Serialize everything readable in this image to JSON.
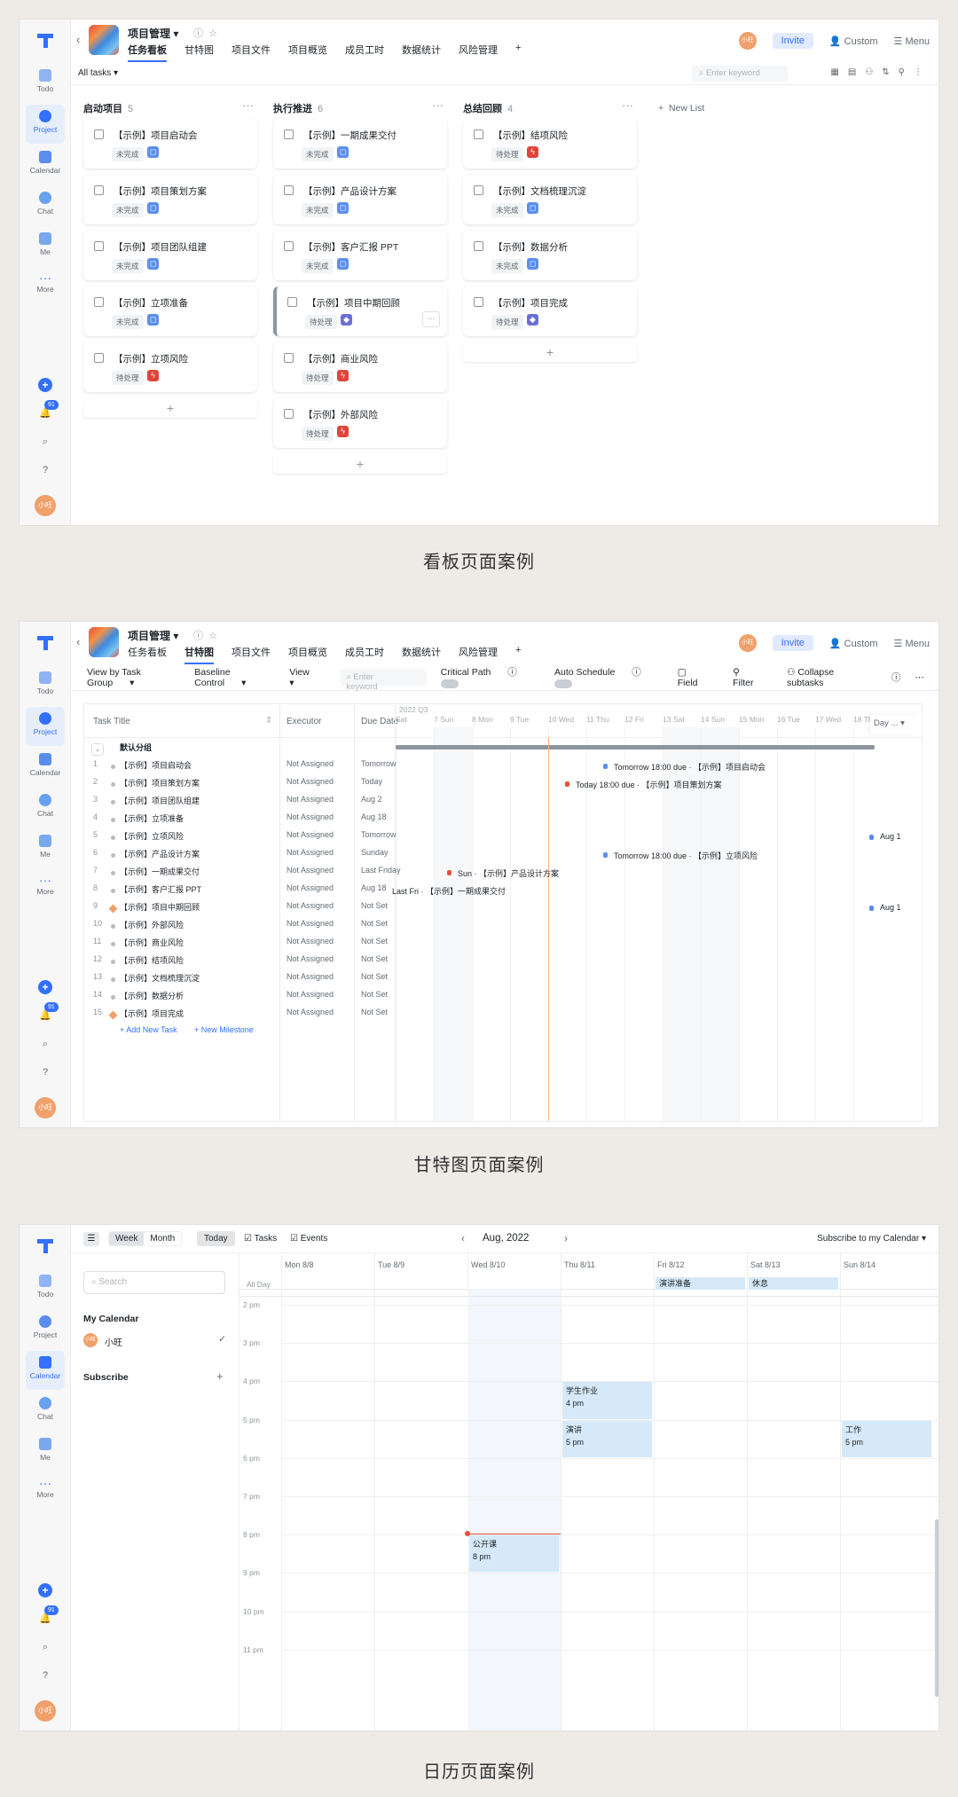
{
  "sidebar": {
    "nav": [
      "Todo",
      "Project",
      "Calendar",
      "Chat",
      "Me",
      "More"
    ],
    "badge": "91",
    "avatar": "小旺"
  },
  "project": {
    "name": "项目管理",
    "tabs": [
      "任务看板",
      "甘特图",
      "项目文件",
      "项目概览",
      "成员工时",
      "数据统计",
      "风险管理"
    ],
    "avatar": "小旺",
    "invite": "Invite",
    "custom": "Custom",
    "menu": "Menu"
  },
  "board": {
    "filter": "All tasks",
    "search_placeholder": "Enter keyword",
    "new_list": "New List",
    "columns": [
      {
        "name": "启动项目",
        "count": "5",
        "cards": [
          {
            "title": "【示例】项目启动会",
            "status": "未完成",
            "prio": "low"
          },
          {
            "title": "【示例】项目策划方案",
            "status": "未完成",
            "prio": "low"
          },
          {
            "title": "【示例】项目团队组建",
            "status": "未完成",
            "prio": "low"
          },
          {
            "title": "【示例】立项准备",
            "status": "未完成",
            "prio": "low"
          },
          {
            "title": "【示例】立项风险",
            "status": "待处理",
            "prio": "high"
          }
        ]
      },
      {
        "name": "执行推进",
        "count": "6",
        "cards": [
          {
            "title": "【示例】一期成果交付",
            "status": "未完成",
            "prio": "low"
          },
          {
            "title": "【示例】产品设计方案",
            "status": "未完成",
            "prio": "low"
          },
          {
            "title": "【示例】客户汇报 PPT",
            "status": "未完成",
            "prio": "low"
          },
          {
            "title": "【示例】项目中期回顾",
            "status": "待处理",
            "prio": "mid"
          },
          {
            "title": "【示例】商业风险",
            "status": "待处理",
            "prio": "high"
          },
          {
            "title": "【示例】外部风险",
            "status": "待处理",
            "prio": "high"
          }
        ]
      },
      {
        "name": "总结回顾",
        "count": "4",
        "cards": [
          {
            "title": "【示例】结项风险",
            "status": "待处理",
            "prio": "high"
          },
          {
            "title": "【示例】文档梳理沉淀",
            "status": "未完成",
            "prio": "low"
          },
          {
            "title": "【示例】数据分析",
            "status": "未完成",
            "prio": "low"
          },
          {
            "title": "【示例】项目完成",
            "status": "待处理",
            "prio": "mid"
          }
        ]
      }
    ],
    "caption": "看板页面案例"
  },
  "gantt": {
    "toolbar": [
      "View by Task Group",
      "Baseline Control",
      "View",
      "Critical Path",
      "Auto Schedule",
      "Field",
      "Filter",
      "Collapse subtasks"
    ],
    "search_placeholder": "Enter keyword",
    "headers": [
      "Task Title",
      "Executor",
      "Due Date"
    ],
    "quarter": "2022 Q3",
    "days": [
      "Sat",
      "7 Sun",
      "8 Mon",
      "9 Tue",
      "10 Wed",
      "11 Thu",
      "12 Fri",
      "13 Sat",
      "14 Sun",
      "15 Mon",
      "16 Tue",
      "17 Wed",
      "18 Thu"
    ],
    "day_select": "Day ...",
    "group": "默认分组",
    "tasks": [
      {
        "n": "1",
        "title": "【示例】项目启动会",
        "exec": "Not Assigned",
        "due": "Tomorrow"
      },
      {
        "n": "2",
        "title": "【示例】项目策划方案",
        "exec": "Not Assigned",
        "due": "Today"
      },
      {
        "n": "3",
        "title": "【示例】项目团队组建",
        "exec": "Not Assigned",
        "due": "Aug 2"
      },
      {
        "n": "4",
        "title": "【示例】立项准备",
        "exec": "Not Assigned",
        "due": "Aug 18"
      },
      {
        "n": "5",
        "title": "【示例】立项风险",
        "exec": "Not Assigned",
        "due": "Tomorrow"
      },
      {
        "n": "6",
        "title": "【示例】产品设计方案",
        "exec": "Not Assigned",
        "due": "Sunday"
      },
      {
        "n": "7",
        "title": "【示例】一期成果交付",
        "exec": "Not Assigned",
        "due": "Last Friday"
      },
      {
        "n": "8",
        "title": "【示例】客户汇报 PPT",
        "exec": "Not Assigned",
        "due": "Aug 18"
      },
      {
        "n": "9",
        "title": "【示例】项目中期回顾",
        "exec": "Not Assigned",
        "due": "Not Set"
      },
      {
        "n": "10",
        "title": "【示例】外部风险",
        "exec": "Not Assigned",
        "due": "Not Set"
      },
      {
        "n": "11",
        "title": "【示例】商业风险",
        "exec": "Not Assigned",
        "due": "Not Set"
      },
      {
        "n": "12",
        "title": "【示例】结项风险",
        "exec": "Not Assigned",
        "due": "Not Set"
      },
      {
        "n": "13",
        "title": "【示例】文档梳理沉淀",
        "exec": "Not Assigned",
        "due": "Not Set"
      },
      {
        "n": "14",
        "title": "【示例】数据分析",
        "exec": "Not Assigned",
        "due": "Not Set"
      },
      {
        "n": "15",
        "title": "【示例】项目完成",
        "exec": "Not Assigned",
        "due": "Not Set"
      }
    ],
    "bars": [
      "Tomorrow 18:00 due · 【示例】项目启动会",
      "Today 18:00 due · 【示例】项目策划方案",
      "Aug 1",
      "Tomorrow 18:00 due · 【示例】立项风险",
      "Sun · 【示例】产品设计方案",
      "Last Fri · 【示例】一期成果交付",
      "Aug 1"
    ],
    "add_task": "+ Add New Task",
    "add_milestone": "+ New Milestone",
    "caption": "甘特图页面案例"
  },
  "calendar": {
    "views": [
      "Week",
      "Month"
    ],
    "today": "Today",
    "toggles": [
      "Tasks",
      "Events"
    ],
    "month": "Aug, 2022",
    "subscribe_link": "Subscribe to my Calendar",
    "search_placeholder": "Search",
    "my_calendar": "My Calendar",
    "user": "小旺",
    "subscribe": "Subscribe",
    "days": [
      "Mon 8/8",
      "Tue 8/9",
      "Wed 8/10",
      "Thu 8/11",
      "Fri 8/12",
      "Sat 8/13",
      "Sun 8/14"
    ],
    "allday": "All Day",
    "hours": [
      "2 pm",
      "3 pm",
      "4 pm",
      "5 pm",
      "6 pm",
      "7 pm",
      "8 pm",
      "9 pm",
      "10 pm",
      "11 pm"
    ],
    "allday_events": [
      "演讲准备",
      "休息"
    ],
    "events": [
      {
        "t": "学生作业",
        "time": "4 pm"
      },
      {
        "t": "演讲",
        "time": "5 pm"
      },
      {
        "t": "工作",
        "time": "5 pm"
      },
      {
        "t": "公开课",
        "time": "8 pm"
      }
    ],
    "caption": "日历页面案例"
  }
}
